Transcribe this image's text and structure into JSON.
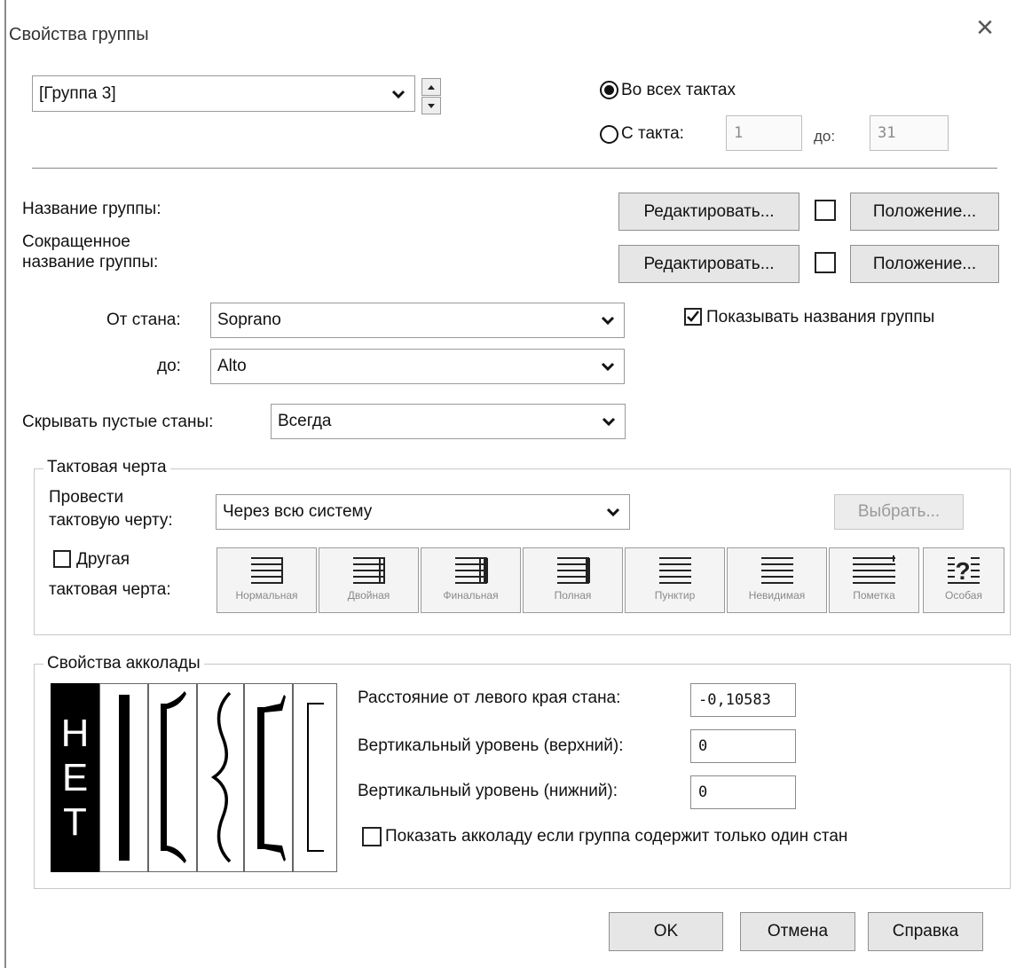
{
  "dialog": {
    "title": "Свойства группы",
    "close": "×"
  },
  "group_select": {
    "value": "[Группа 3]"
  },
  "range": {
    "all_label": "Во всех тактах",
    "from_label": "С такта:",
    "from_value": "1",
    "to_label": "до:",
    "to_value": "31",
    "all_selected": true
  },
  "names": {
    "full_label": "Название группы:",
    "abbr_label_line1": "Сокращенное",
    "abbr_label_line2": "название группы:",
    "edit_label": "Редактировать...",
    "position_label": "Положение..."
  },
  "staves": {
    "from_label": "От стана:",
    "from_value": "Soprano",
    "to_label": "до:",
    "to_value": "Alto",
    "show_names_label": "Показывать названия группы",
    "show_names_checked": true
  },
  "hide_empty": {
    "label": "Скрывать пустые станы:",
    "value": "Всегда"
  },
  "barline": {
    "legend": "Тактовая черта",
    "draw_label_line1": "Провести",
    "draw_label_line2": "тактовую черту:",
    "draw_value": "Через всю систему",
    "choose_label": "Выбрать...",
    "other_label_line1": "Другая",
    "other_label_line2": "тактовая черта:",
    "types": [
      "Нормальная",
      "Двойная",
      "Финальная",
      "Полная",
      "Пунктир",
      "Невидимая",
      "Пометка",
      "Особая"
    ]
  },
  "bracket": {
    "legend": "Свойства акколады",
    "none_letters": [
      "Н",
      "Е",
      "Т"
    ],
    "distance_label": "Расстояние от левого края стана:",
    "distance_value": "-0,10583",
    "top_label": "Вертикальный уровень (верхний):",
    "top_value": "0",
    "bottom_label": "Вертикальный уровень (нижний):",
    "bottom_value": "0",
    "single_label": "Показать акколаду если группа содержит только один стан"
  },
  "footer": {
    "ok": "OK",
    "cancel": "Отмена",
    "help": "Справка"
  },
  "colors": {
    "selected_tile": "#000000",
    "button_face": "#e6e6e6",
    "border": "#8f8f8f"
  }
}
